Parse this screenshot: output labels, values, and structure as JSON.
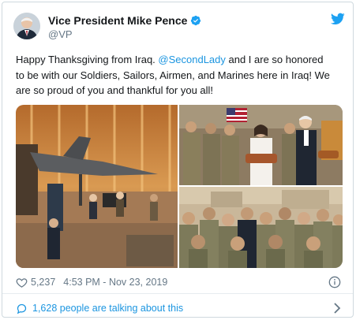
{
  "tweet": {
    "display_name": "Vice President Mike Pence",
    "handle": "@VP",
    "verified": true,
    "text_before": "Happy Thanksgiving from Iraq. ",
    "mention": "@SecondLady",
    "text_after": " and I are so honored to be with our Soldiers, Sailors, Airmen, and Marines here in Iraq! We are so proud of you and thankful for you all!",
    "likes": "5,237",
    "timestamp": "4:53 PM - Nov 23, 2019",
    "talking": "1,628 people are talking about this"
  },
  "icons": {
    "verified": "verified-badge-icon",
    "bird": "twitter-bird-icon",
    "heart": "heart-icon",
    "info": "info-icon",
    "bubble": "speech-bubble-icon",
    "chevron": "chevron-right-icon"
  },
  "colors": {
    "link": "#1b95e0",
    "text": "#14171a",
    "muted": "#657786",
    "border": "#cfd9de"
  }
}
